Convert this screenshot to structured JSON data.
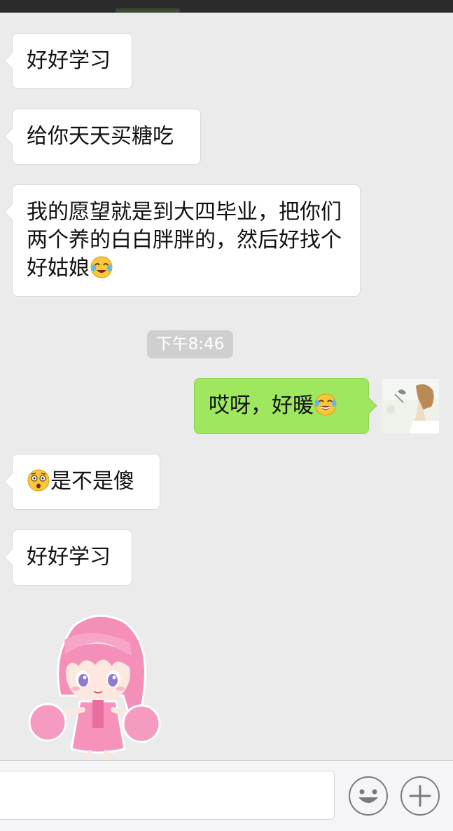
{
  "messages": [
    {
      "side": "left",
      "text": "好好学习"
    },
    {
      "side": "left",
      "text": "给你天天买糖吃"
    },
    {
      "side": "left",
      "text": "我的愿望就是到大四毕业，把你们两个养的白白胖胖的，然后好找个好姑娘",
      "emoji": "crying-laughing-face"
    },
    {
      "side": "right",
      "text": "哎呀，好暖",
      "emoji": "tears-of-joy-face"
    },
    {
      "side": "left",
      "text": "是不是傻",
      "emoji": "shocked-face",
      "emoji_position": "before"
    },
    {
      "side": "left",
      "text": "好好学习"
    }
  ],
  "timestamp": "下午8:46",
  "sticker": "pink-hair-girl-cheerleader-sticker",
  "input": {
    "value": "",
    "emoji_button_icon": "smiley-face-icon",
    "more_button_icon": "plus-icon"
  },
  "colors": {
    "background": "#ebebeb",
    "sent_bubble": "#9fe75f",
    "received_bubble": "#ffffff",
    "timestamp_bg": "#cfcfcf"
  }
}
